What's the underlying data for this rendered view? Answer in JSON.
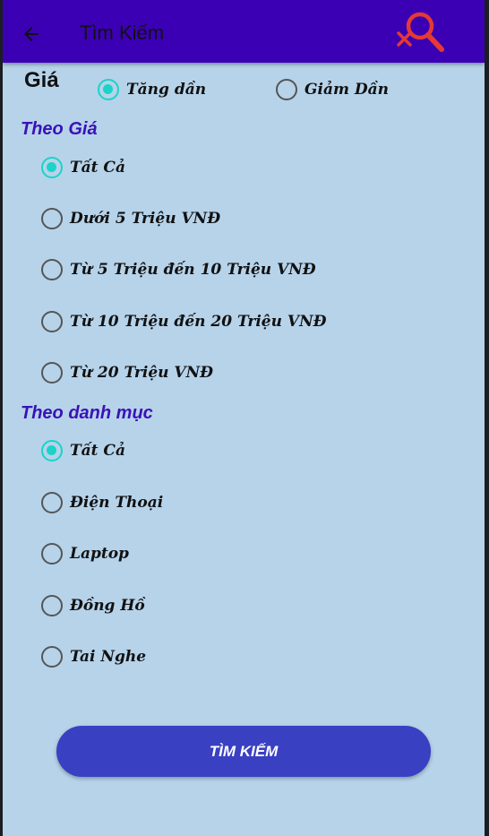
{
  "appbar": {
    "title": "Tìm Kiếm",
    "back_icon": "arrow-left-icon",
    "action_icon": "search-clear-icon",
    "background": "#3b00b4",
    "action_color": "#e53935"
  },
  "sort": {
    "label": "Giá",
    "options": [
      {
        "label": "Tăng dần",
        "checked": true
      },
      {
        "label": "Giảm Dần",
        "checked": false
      }
    ]
  },
  "price_filter": {
    "title": "Theo Giá",
    "options": [
      {
        "label": "Tất Cả",
        "checked": true
      },
      {
        "label": "Dưới 5 Triệu VNĐ",
        "checked": false
      },
      {
        "label": "Từ 5 Triệu đến 10 Triệu VNĐ",
        "checked": false
      },
      {
        "label": "Từ 10 Triệu đến 20 Triệu VNĐ",
        "checked": false
      },
      {
        "label": "Từ 20 Triệu VNĐ",
        "checked": false
      }
    ]
  },
  "category_filter": {
    "title": "Theo danh mục",
    "options": [
      {
        "label": "Tất Cả",
        "checked": true
      },
      {
        "label": "Điện Thoại",
        "checked": false
      },
      {
        "label": "Laptop",
        "checked": false
      },
      {
        "label": "Đồng Hồ",
        "checked": false
      },
      {
        "label": "Tai Nghe",
        "checked": false
      }
    ]
  },
  "search_button": {
    "label": "TÌM KIẾM"
  },
  "colors": {
    "screen_bg": "#b6d3ea",
    "radio_checked": "#1bd3c8",
    "section_title": "#3a12b8",
    "button_bg": "#3940c2"
  }
}
